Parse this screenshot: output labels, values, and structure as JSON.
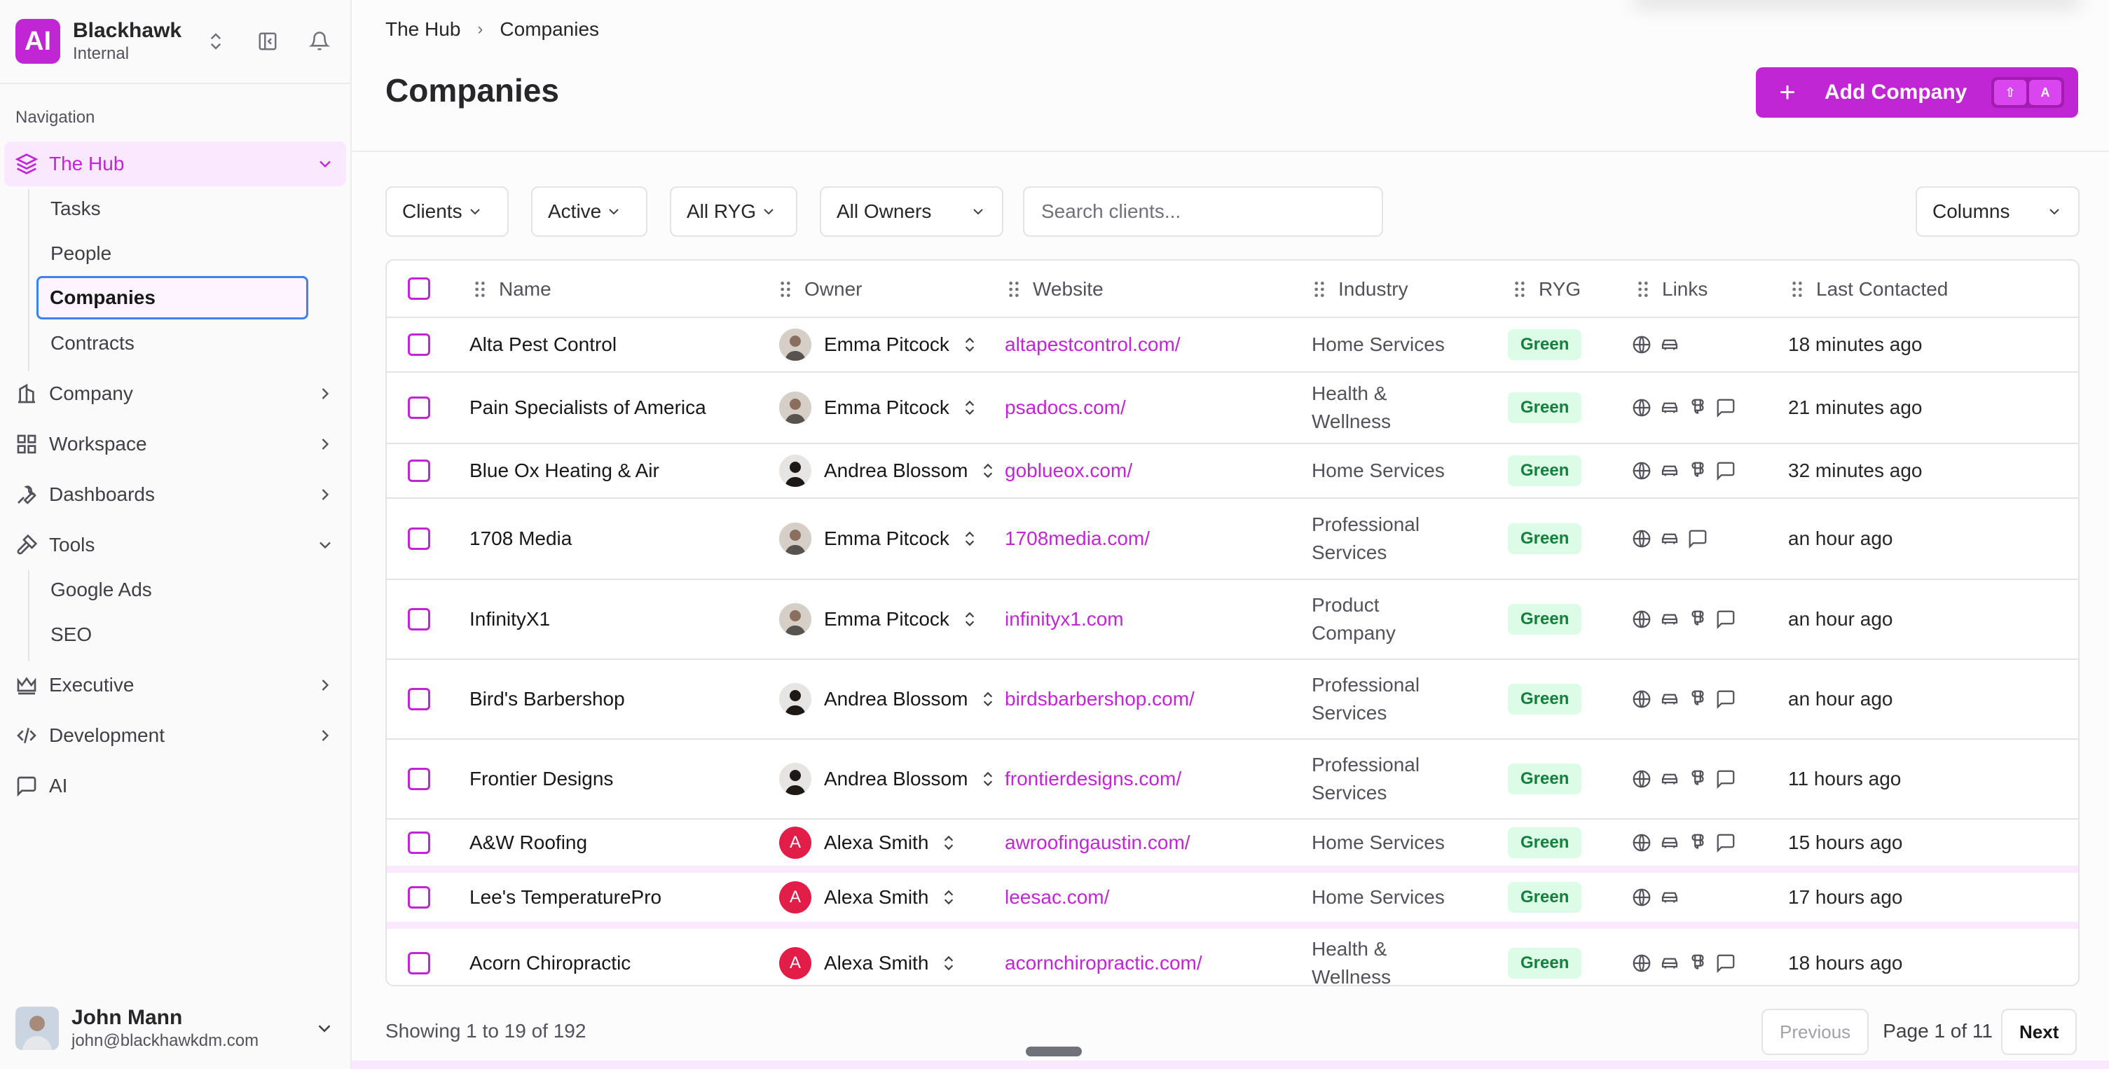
{
  "workspace": {
    "logo": "AI",
    "name": "Blackhawk",
    "subtitle": "Internal"
  },
  "nav": {
    "heading": "Navigation",
    "hub": "The Hub",
    "hub_items": [
      "Tasks",
      "People",
      "Companies",
      "Contracts"
    ],
    "company": "Company",
    "workspace": "Workspace",
    "dashboards": "Dashboards",
    "tools": "Tools",
    "tools_items": [
      "Google Ads",
      "SEO"
    ],
    "executive": "Executive",
    "development": "Development",
    "ai": "AI"
  },
  "user": {
    "name": "John Mann",
    "email": "john@blackhawkdm.com"
  },
  "breadcrumb": {
    "root": "The Hub",
    "current": "Companies"
  },
  "page": {
    "title": "Companies"
  },
  "add_button": {
    "label": "Add Company",
    "plus": "+",
    "key1": "⇧",
    "key2": "A"
  },
  "filters": {
    "type": "Clients",
    "status": "Active",
    "ryg": "All RYG",
    "owners": "All Owners",
    "search_placeholder": "Search clients...",
    "columns": "Columns"
  },
  "columns": [
    "Name",
    "Owner",
    "Website",
    "Industry",
    "RYG",
    "Links",
    "Last Contacted"
  ],
  "rows": [
    {
      "name": "Alta Pest Control",
      "owner": "Emma Pitcock",
      "owner_av": "photo1",
      "website": "altapestcontrol.com/",
      "industry": "Home Services",
      "ryg": "Green",
      "links": [
        "globe",
        "car"
      ],
      "last": "18 minutes ago"
    },
    {
      "name": "Pain Specialists of America",
      "owner": "Emma Pitcock",
      "owner_av": "photo1",
      "website": "psadocs.com/",
      "industry": "Health & Wellness",
      "ryg": "Green",
      "links": [
        "globe",
        "car",
        "figma",
        "chat"
      ],
      "last": "21 minutes ago"
    },
    {
      "name": "Blue Ox Heating & Air",
      "owner": "Andrea Blossom",
      "owner_av": "photo2",
      "website": "goblueox.com/",
      "industry": "Home Services",
      "ryg": "Green",
      "links": [
        "globe",
        "car",
        "figma",
        "chat"
      ],
      "last": "32 minutes ago"
    },
    {
      "name": "1708 Media",
      "owner": "Emma Pitcock",
      "owner_av": "photo1",
      "website": "1708media.com/",
      "industry": "Professional Services",
      "ryg": "Green",
      "links": [
        "globe",
        "car",
        "chat"
      ],
      "last": "an hour ago"
    },
    {
      "name": "InfinityX1",
      "owner": "Emma Pitcock",
      "owner_av": "photo1",
      "website": "infinityx1.com",
      "industry": "Product Company",
      "ryg": "Green",
      "links": [
        "globe",
        "car",
        "figma",
        "chat"
      ],
      "last": "an hour ago"
    },
    {
      "name": "Bird's Barbershop",
      "owner": "Andrea Blossom",
      "owner_av": "photo2",
      "website": "birdsbarbershop.com/",
      "industry": "Professional Services",
      "ryg": "Green",
      "links": [
        "globe",
        "car",
        "figma",
        "chat"
      ],
      "last": "an hour ago"
    },
    {
      "name": "Frontier Designs",
      "owner": "Andrea Blossom",
      "owner_av": "photo2",
      "website": "frontierdesigns.com/",
      "industry": "Professional Services",
      "ryg": "Green",
      "links": [
        "globe",
        "car",
        "figma",
        "chat"
      ],
      "last": "11 hours ago"
    },
    {
      "name": "A&W Roofing",
      "owner": "Alexa Smith",
      "owner_av": "A",
      "website": "awroofingaustin.com/",
      "industry": "Home Services",
      "ryg": "Green",
      "links": [
        "globe",
        "car",
        "figma",
        "chat"
      ],
      "last": "15 hours ago"
    },
    {
      "name": "Lee's TemperaturePro",
      "owner": "Alexa Smith",
      "owner_av": "A",
      "website": "leesac.com/",
      "industry": "Home Services",
      "ryg": "Green",
      "links": [
        "globe",
        "car"
      ],
      "last": "17 hours ago"
    },
    {
      "name": "Acorn Chiropractic",
      "owner": "Alexa Smith",
      "owner_av": "A",
      "website": "acornchiropractic.com/",
      "industry": "Health & Wellness",
      "ryg": "Green",
      "links": [
        "globe",
        "car",
        "figma",
        "chat"
      ],
      "last": "18 hours ago"
    }
  ],
  "footer": {
    "showing": "Showing 1 to 19 of 192",
    "previous": "Previous",
    "page": "Page 1 of 11",
    "next": "Next"
  },
  "colors": {
    "accent": "#c026d3",
    "accent_soft": "#fae8ff",
    "green_bg": "#dcfce7",
    "green_text": "#15803d"
  }
}
